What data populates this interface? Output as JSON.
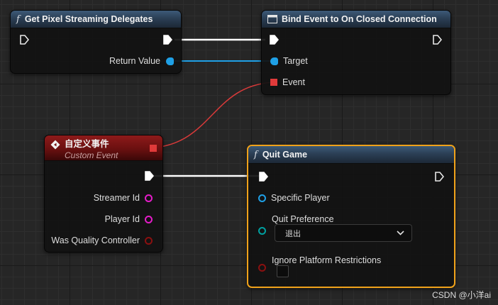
{
  "nodes": {
    "get_delegates": {
      "title": "Get Pixel Streaming Delegates",
      "return_label": "Return Value"
    },
    "bind_event": {
      "title": "Bind Event to On Closed Connection",
      "target_label": "Target",
      "event_label": "Event"
    },
    "custom_event": {
      "title": "自定义事件",
      "subtitle": "Custom Event",
      "pins": [
        "Streamer Id",
        "Player Id",
        "Was Quality Controller"
      ]
    },
    "quit_game": {
      "title": "Quit Game",
      "specific_player_label": "Specific Player",
      "quit_preference_label": "Quit Preference",
      "quit_preference_value": "退出",
      "ignore_restrictions_label": "Ignore Platform Restrictions"
    }
  },
  "icons": {
    "function": "italic-f",
    "event": "diamond-event",
    "exec": "exec-arrow",
    "bind_header": "window-icon"
  },
  "colors": {
    "exec_wire": "#ffffff",
    "object_pin": "#1fa0e6",
    "delegate_pin": "#e03a3a",
    "string_pin": "#e51cc9",
    "bool_pin": "#8a1010",
    "enum_pin": "#00a0a0",
    "function_header": "#2e4660",
    "event_header": "#7a1414",
    "selected_outline": "#f0a21a"
  },
  "watermark": "CSDN @小洋ai"
}
